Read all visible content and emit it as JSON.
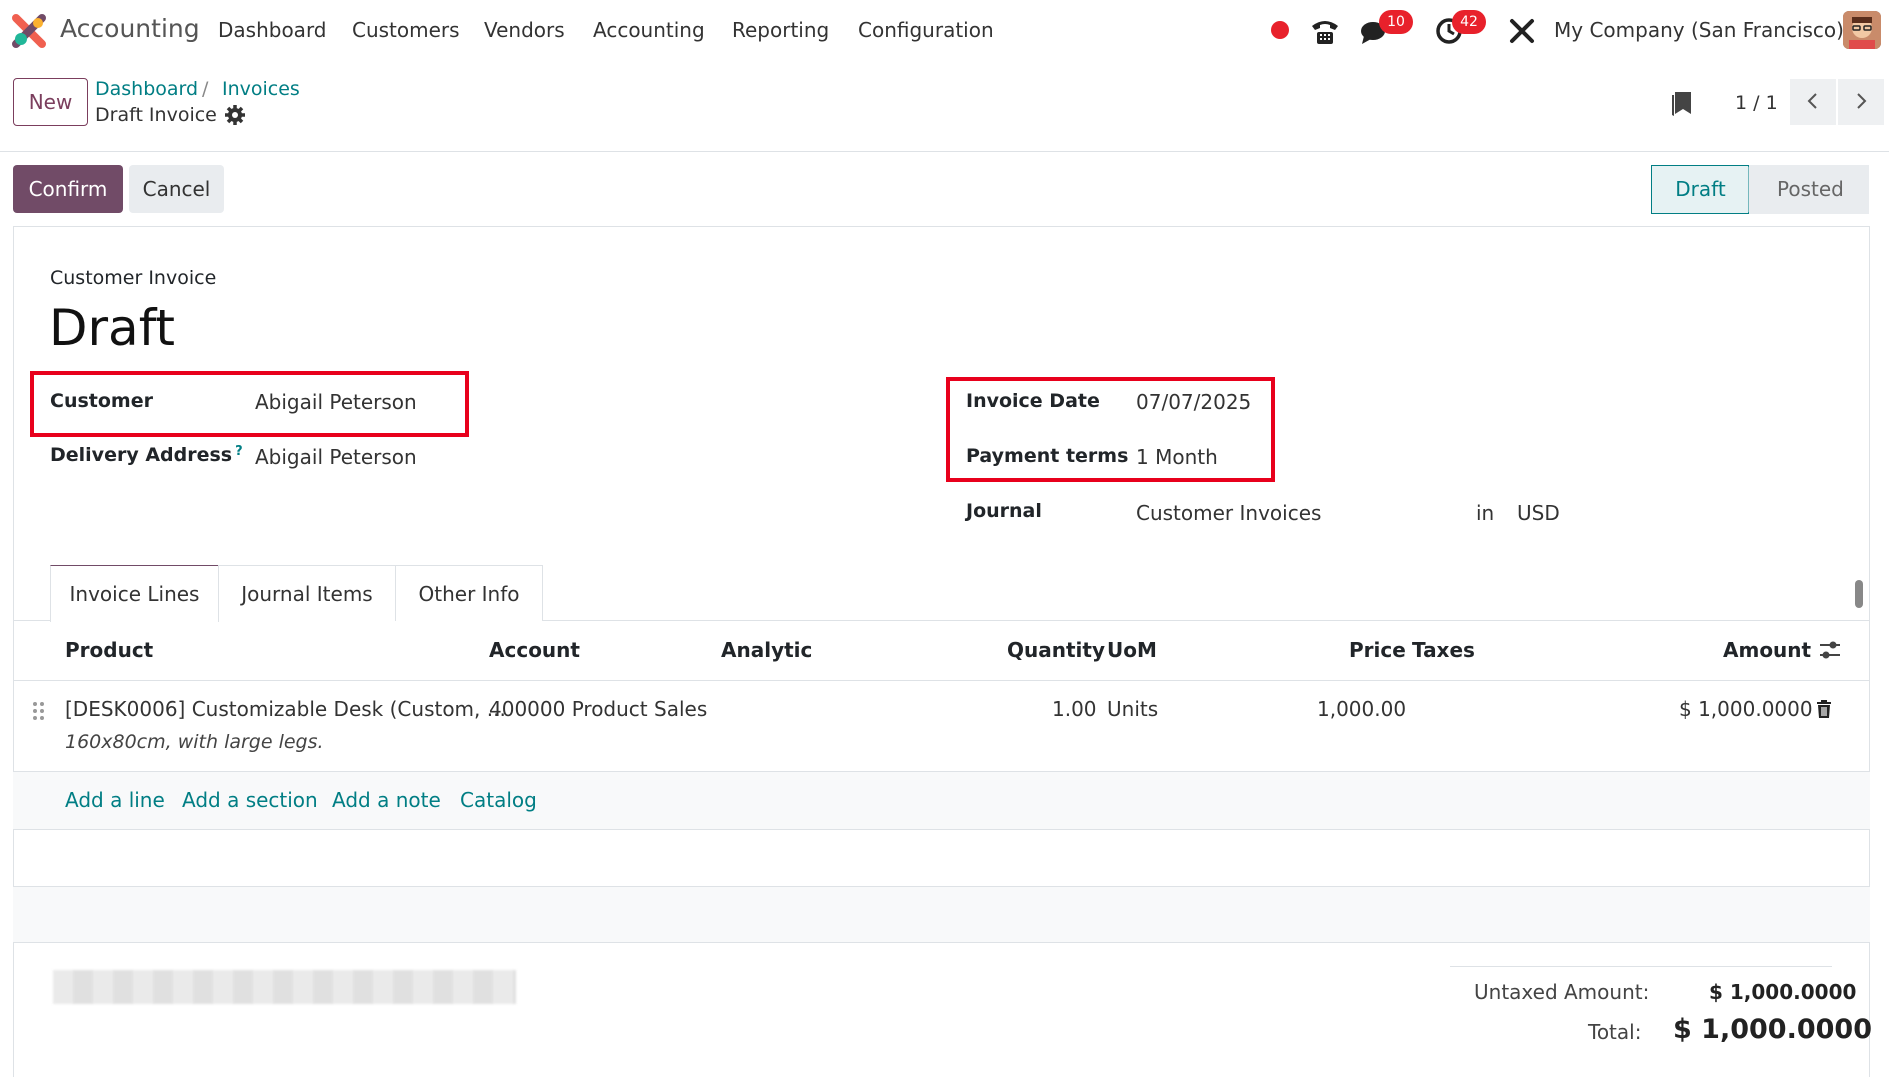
{
  "navbar": {
    "app_name": "Accounting",
    "menu": [
      "Dashboard",
      "Customers",
      "Vendors",
      "Accounting",
      "Reporting",
      "Configuration"
    ],
    "messages_badge": "10",
    "activities_badge": "42",
    "company": "My Company (San Francisco)",
    "accent_color": "#714b67"
  },
  "control_panel": {
    "new_label": "New",
    "breadcrumb": [
      "Dashboard",
      "Invoices"
    ],
    "record_name": "Draft Invoice",
    "pager": "1 / 1"
  },
  "statusbar": {
    "confirm_label": "Confirm",
    "cancel_label": "Cancel",
    "stages": [
      "Draft",
      "Posted"
    ],
    "active_stage": "Draft"
  },
  "form": {
    "doc_type": "Customer Invoice",
    "title": "Draft",
    "customer_label": "Customer",
    "customer_value": "Abigail Peterson",
    "delivery_label": "Delivery Address",
    "delivery_help": "?",
    "delivery_value": "Abigail Peterson",
    "invoice_date_label": "Invoice Date",
    "invoice_date_value": "07/07/2025",
    "payment_terms_label": "Payment terms",
    "payment_terms_value": "1 Month",
    "journal_label": "Journal",
    "journal_value": "Customer Invoices",
    "journal_in": "in",
    "currency": "USD"
  },
  "tabs": [
    "Invoice Lines",
    "Journal Items",
    "Other Info"
  ],
  "table": {
    "headers": [
      "Product",
      "Account",
      "Analytic",
      "Quantity",
      "UoM",
      "Price",
      "Taxes",
      "Amount"
    ],
    "rows": [
      {
        "product": "[DESK0006] Customizable Desk (Custom, ...",
        "description": "160x80cm, with large legs.",
        "account": "400000 Product Sales",
        "quantity": "1.00",
        "uom": "Units",
        "price": "1,000.00",
        "amount": "$ 1,000.0000"
      }
    ],
    "add_links": [
      "Add a line",
      "Add a section",
      "Add a note",
      "Catalog"
    ]
  },
  "totals": {
    "untaxed_label": "Untaxed Amount:",
    "untaxed_value": "$ 1,000.0000",
    "total_label": "Total:",
    "total_value": "$ 1,000.0000"
  }
}
